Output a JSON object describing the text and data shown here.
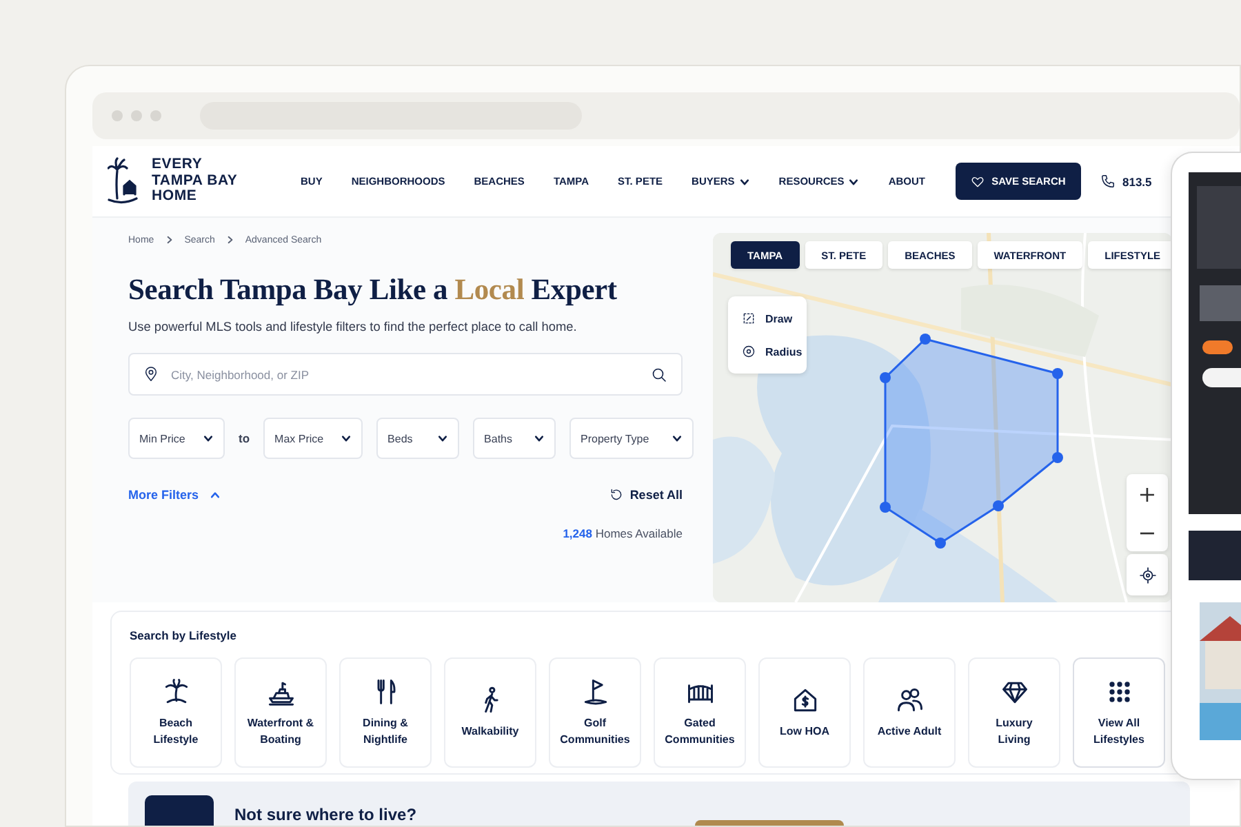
{
  "header": {
    "logo_lines": [
      "EVERY",
      "TAMPA BAY",
      "HOME"
    ],
    "nav": [
      {
        "label": "BUY",
        "dropdown": false
      },
      {
        "label": "NEIGHBORHOODS",
        "dropdown": false
      },
      {
        "label": "BEACHES",
        "dropdown": false
      },
      {
        "label": "TAMPA",
        "dropdown": false
      },
      {
        "label": "ST. PETE",
        "dropdown": false
      },
      {
        "label": "BUYERS",
        "dropdown": true
      },
      {
        "label": "RESOURCES",
        "dropdown": true
      },
      {
        "label": "ABOUT",
        "dropdown": false
      }
    ],
    "save_button": "SAVE SEARCH",
    "phone": "813.5"
  },
  "breadcrumb": [
    "Home",
    "Search",
    "Advanced Search"
  ],
  "heading": {
    "before": "Search Tampa Bay Like a ",
    "highlight": "Local",
    "after": " Expert"
  },
  "subtitle": "Use powerful MLS tools and lifestyle filters to find the perfect place to call home.",
  "search": {
    "placeholder": "City, Neighborhood, or ZIP"
  },
  "filters": [
    {
      "kind": "select",
      "label": "Min Price"
    },
    {
      "kind": "word",
      "label": "to"
    },
    {
      "kind": "select",
      "label": "Max Price"
    },
    {
      "kind": "select",
      "label": "Beds"
    },
    {
      "kind": "select",
      "label": "Baths"
    },
    {
      "kind": "select",
      "label": "Property Type"
    }
  ],
  "more_filters": {
    "label": "More Filters",
    "expanded": true
  },
  "reset": "Reset All",
  "results": {
    "count": "1,248",
    "label": "Homes Available"
  },
  "map": {
    "tabs": [
      {
        "label": "TAMPA",
        "selected": true
      },
      {
        "label": "ST. PETE",
        "selected": false
      },
      {
        "label": "BEACHES",
        "selected": false
      },
      {
        "label": "WATERFRONT",
        "selected": false
      },
      {
        "label": "LIFESTYLE",
        "selected": false
      }
    ],
    "tools": [
      {
        "kind": "draw",
        "label": "Draw"
      },
      {
        "kind": "radius",
        "label": "Radius"
      }
    ],
    "zoom_in": "+",
    "zoom_out": "−"
  },
  "lifestyle": {
    "title": "Search by Lifestyle",
    "items": [
      {
        "kind": "beach",
        "label": "Beach\nLifestyle"
      },
      {
        "kind": "boat",
        "label": "Waterfront &\nBoating"
      },
      {
        "kind": "dining",
        "label": "Dining &\nNightlife"
      },
      {
        "kind": "walk",
        "label": "Walkability"
      },
      {
        "kind": "golf",
        "label": "Golf\nCommunities"
      },
      {
        "kind": "gate",
        "label": "Gated\nCommunities"
      },
      {
        "kind": "hoa",
        "label": "Low HOA"
      },
      {
        "kind": "adult",
        "label": "Active Adult"
      },
      {
        "kind": "luxury",
        "label": "Luxury\nLiving"
      },
      {
        "kind": "all",
        "label": "View All\nLifestyles"
      }
    ]
  },
  "banner": {
    "title": "Not sure where to live?"
  }
}
